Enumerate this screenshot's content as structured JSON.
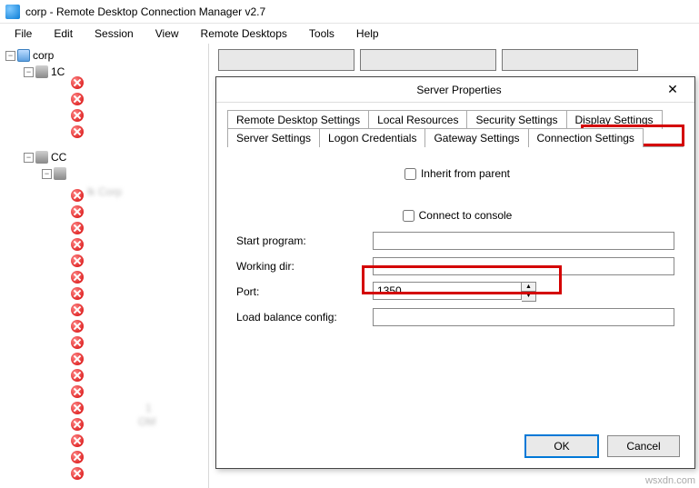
{
  "window": {
    "title": "corp - Remote Desktop Connection Manager v2.7"
  },
  "menu": [
    "File",
    "Edit",
    "Session",
    "View",
    "Remote Desktops",
    "Tools",
    "Help"
  ],
  "tree": {
    "root": "corp",
    "group1": "1C",
    "group2": "CC",
    "blur1": "lk Corp",
    "blur2": "1",
    "blur3": "OM"
  },
  "dialog": {
    "title": "Server Properties",
    "tabs_row1": [
      "Remote Desktop Settings",
      "Local Resources",
      "Security Settings",
      "Display Settings"
    ],
    "tabs_row2": [
      "Server Settings",
      "Logon Credentials",
      "Gateway Settings",
      "Connection Settings"
    ],
    "active_tab": "Connection Settings",
    "inherit_label": "Inherit from parent",
    "inherit_checked": false,
    "connect_console_label": "Connect to console",
    "connect_console_checked": false,
    "fields": {
      "start_program": {
        "label": "Start program:",
        "value": ""
      },
      "working_dir": {
        "label": "Working dir:",
        "value": ""
      },
      "port": {
        "label": "Port:",
        "value": "1350"
      },
      "load_balance": {
        "label": "Load balance config:",
        "value": ""
      }
    },
    "ok": "OK",
    "cancel": "Cancel"
  },
  "watermark": "wsxdn.com"
}
